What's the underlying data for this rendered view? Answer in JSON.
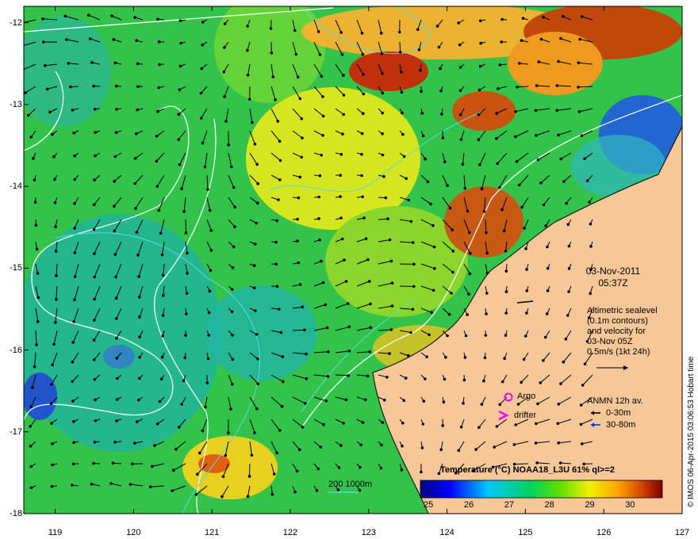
{
  "axes": {
    "lon_ticks": [
      119,
      120,
      121,
      122,
      123,
      124,
      125,
      126,
      127
    ],
    "lat_ticks": [
      -12,
      -13,
      -14,
      -15,
      -16,
      -17,
      -18
    ],
    "lon_range": [
      118.6,
      127.0
    ],
    "lat_range": [
      -18.0,
      -11.8
    ]
  },
  "timestamp": {
    "date": "03-Nov-2011",
    "time": "05:37Z"
  },
  "altimetry": {
    "lines": [
      "Altimetric sealevel",
      "(0.1m contours)",
      "and velocity for",
      "03-Nov 05Z",
      "0.5m/s (1kt 24h)"
    ]
  },
  "legend": {
    "argo": "Argo",
    "drifter": "drifter",
    "anmn_title": "ANMN 12h av.",
    "anmn_shallow": "0-30m",
    "anmn_deep": "30-80m"
  },
  "isobath_label": "200  1000m",
  "colorbar": {
    "title": "Temperature (°C) NOAA18_L3U 61% ql>=2",
    "ticks": [
      25,
      26,
      27,
      28,
      29,
      30
    ],
    "range": [
      24.8,
      30.8
    ]
  },
  "credit": "© IMOS 06-Apr-2015 03:06:53 Hobart time",
  "colors": {
    "land": "#f7c797",
    "coast": "#000000",
    "sealevel_contour": "#ffffff",
    "isobath": "#55dddd",
    "argo": "#ff00ff",
    "drifter": "#ff00ff",
    "anmn_shallow": "#000000",
    "anmn_deep": "#0033cc"
  }
}
